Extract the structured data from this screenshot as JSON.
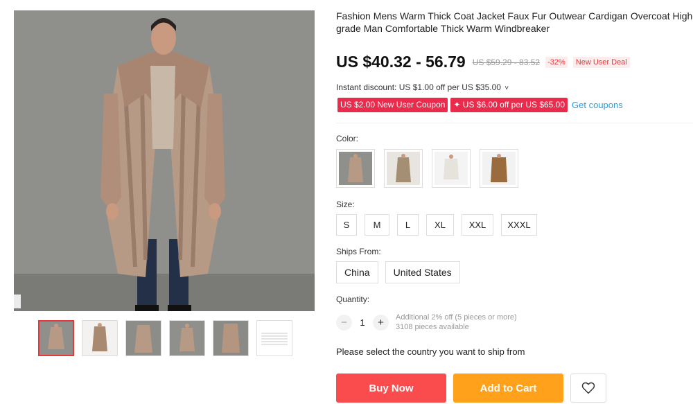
{
  "product": {
    "title": "Fashion Mens Warm Thick Coat Jacket Faux Fur Outwear Cardigan Overcoat High-grade Man Comfortable Thick Warm Windbreaker"
  },
  "gallery": {
    "main_icon": "product-photo",
    "thumb_count": 6,
    "active_thumb": 1
  },
  "pricing": {
    "price": "US $40.32 - 56.79",
    "original_price": "US $59.29 - 83.52",
    "discount": "-32%",
    "deal_badge": "New User Deal",
    "instant_discount": "Instant discount: US $1.00 off per US $35.00",
    "instant_chevron": "˅"
  },
  "coupons": {
    "coupon_1": "US $2.00 New User Coupon",
    "coupon_2": "✦ US $6.00 off per US $65.00",
    "get_coupons": "Get coupons"
  },
  "options": {
    "color_label": "Color:",
    "size_label": "Size:",
    "ships_from_label": "Ships From:",
    "quantity_label": "Quantity:",
    "sizes": [
      "S",
      "M",
      "L",
      "XL",
      "XXL",
      "XXXL"
    ],
    "ships_from": [
      "China",
      "United States"
    ]
  },
  "quantity": {
    "minus": "−",
    "value": "1",
    "plus": "+",
    "note_1": "Additional 2% off (5 pieces or more)",
    "note_2": "3108 pieces available"
  },
  "shipping_warning": "Please select the country you want to ship from",
  "actions": {
    "buy_now": "Buy Now",
    "add_to_cart": "Add to Cart",
    "wishlist_icon": "heart-icon"
  },
  "colors": {
    "accent_red": "#fa4c4c",
    "accent_orange": "#ffa11a",
    "coupon_pink": "#ea2b4c",
    "link_blue": "#2d9cdb"
  }
}
